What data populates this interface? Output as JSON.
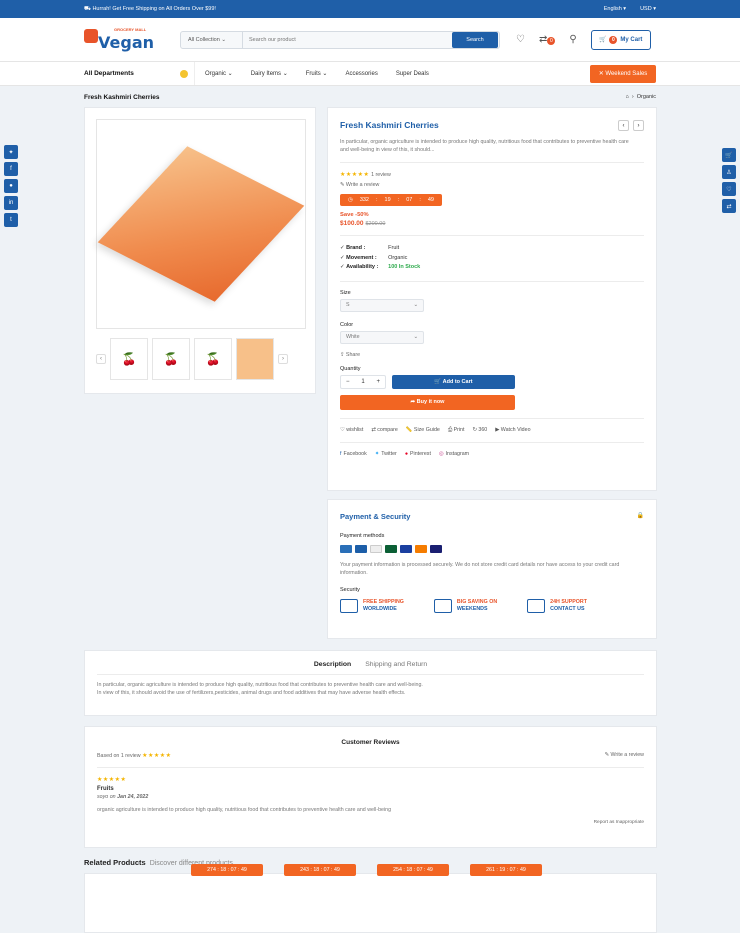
{
  "topbar": {
    "promo": "Hurrah! Get Free Shipping on All Orders Over $99!",
    "language": "English",
    "currency": "USD"
  },
  "header": {
    "logo_brand": "Vegan",
    "logo_sub": "GROCERY MALL",
    "search_category": "All Collection",
    "search_placeholder": "Search our product",
    "search_button": "Search",
    "compare_count": "0",
    "cart_count": "0",
    "cart_label": "My Cart"
  },
  "nav": {
    "departments": "All Departments",
    "items": [
      "Organic",
      "Dairy Items",
      "Fruits",
      "Accessories",
      "Super Deals"
    ],
    "weekend": "Weekend Sales"
  },
  "breadcrumb": {
    "page_title": "Fresh Kashmiri Cherries",
    "current": "Organic"
  },
  "product": {
    "title": "Fresh Kashmiri Cherries",
    "description": "In particular, organic agriculture is intended to produce high quality, nutritious food that contributes to preventive health care and well-being in view of this, it should...",
    "stars": "★★★★★",
    "review_count": "1 review",
    "write_review": "Write a review",
    "timer": {
      "days": "332",
      "hours": "19",
      "mins": "07",
      "secs": "49"
    },
    "save": "Save -50%",
    "price": "$100.00",
    "old_price": "$200.00",
    "brand_label": "Brand :",
    "brand": "Fruit",
    "movement_label": "Movement :",
    "movement": "Organic",
    "availability_label": "Availability :",
    "availability": "100 In Stock",
    "size_label": "Size",
    "size_value": "S",
    "color_label": "Color",
    "color_value": "White",
    "share": "Share",
    "quantity_label": "Quantity",
    "quantity": "1",
    "add_to_cart": "Add to Cart",
    "buy_now": "Buy it now",
    "actions": [
      "wishlist",
      "compare",
      "Size Guide",
      "Print",
      "360",
      "Watch Video"
    ],
    "socials": [
      "Facebook",
      "Twitter",
      "Pinterest",
      "Instagram"
    ]
  },
  "payment": {
    "title": "Payment & Security",
    "methods_label": "Payment methods",
    "note": "Your payment information is processed securely. We do not store credit card details nor have access to your credit card information.",
    "security_label": "Security",
    "features": [
      {
        "l1": "FREE SHIPPING",
        "l2": "WORLDWIDE"
      },
      {
        "l1": "BIG SAVING ON",
        "l2": "WEEKENDS"
      },
      {
        "l1": "24H SUPPORT",
        "l2": "CONTACT US"
      }
    ]
  },
  "tabs": {
    "description": "Description",
    "shipping": "Shipping and Return",
    "text1": "In particular, organic agriculture is intended to produce high quality, nutritious food that contributes to preventive health care and well-being.",
    "text2": "In view of this, it should avoid the use of fertilizers,pesticides, animal drugs and food additives that may have adverse health effects."
  },
  "reviews": {
    "title": "Customer Reviews",
    "based_on": "Based on 1 review",
    "stars": "★★★★★",
    "write": "Write a review",
    "item_title": "Fruits",
    "author": "soyo",
    "on": "on",
    "date": "Jan 24, 2022",
    "body": "organic agriculture is intended to produce high quality, nutritious food that contributes to preventive health care and well-being",
    "report": "Report as Inappropriate"
  },
  "related": {
    "title": "Related Products",
    "subtitle": "Discover different products",
    "timers": [
      "274 : 18 : 07 : 49",
      "243 : 18 : 07 : 49",
      "254 : 18 : 07 : 49",
      "261 : 19 : 07 : 49"
    ]
  }
}
